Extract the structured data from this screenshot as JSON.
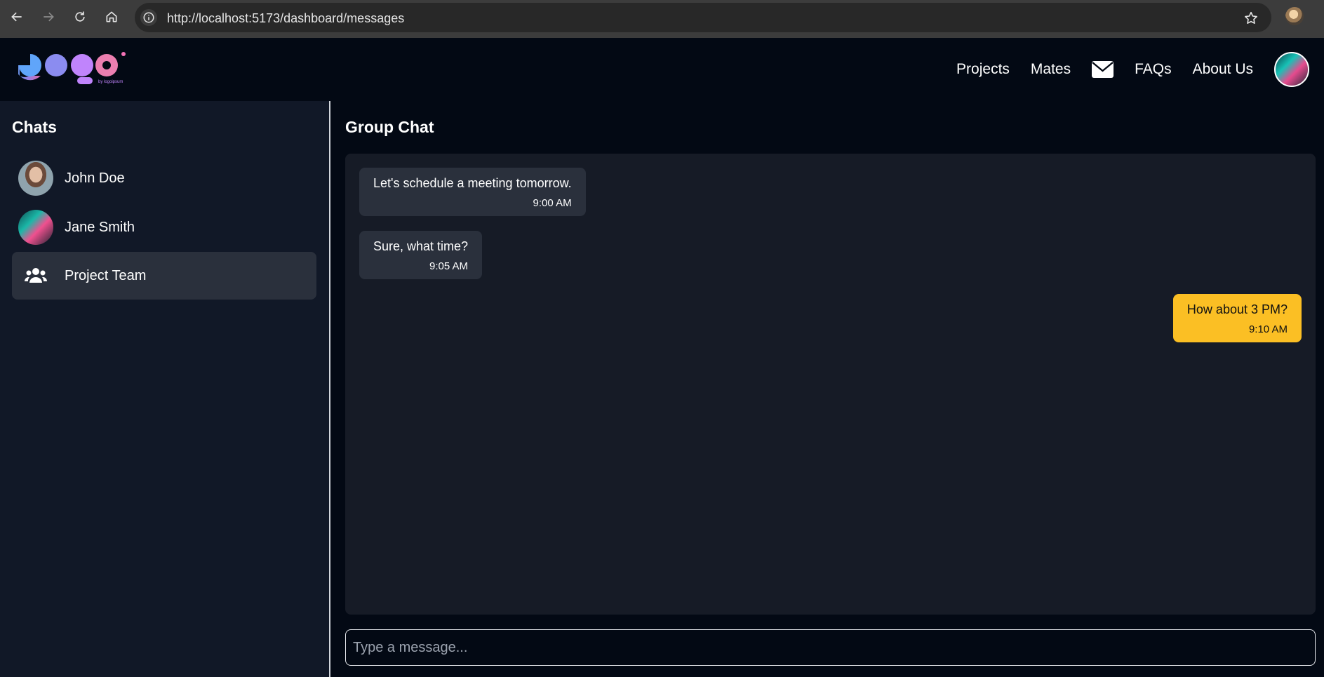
{
  "browser": {
    "url": "http://localhost:5173/dashboard/messages",
    "icons": [
      "back-arrow-icon",
      "forward-arrow-icon",
      "reload-icon",
      "home-icon",
      "info-icon",
      "star-icon"
    ]
  },
  "header": {
    "nav": {
      "projects": "Projects",
      "mates": "Mates",
      "faqs": "FAQs",
      "about": "About Us"
    },
    "icons": [
      "mail-icon"
    ]
  },
  "sidebar": {
    "title": "Chats",
    "items": [
      {
        "name": "John Doe",
        "avatar": "photo"
      },
      {
        "name": "Jane Smith",
        "avatar": "photo"
      },
      {
        "name": "Project Team",
        "avatar": "users-icon",
        "active": true
      }
    ]
  },
  "main": {
    "title": "Group Chat",
    "messages": [
      {
        "text": "Let's schedule a meeting tomorrow.",
        "time": "9:00 AM",
        "direction": "incoming"
      },
      {
        "text": "Sure, what time?",
        "time": "9:05 AM",
        "direction": "incoming"
      },
      {
        "text": "How about 3 PM?",
        "time": "9:10 AM",
        "direction": "outgoing"
      }
    ],
    "composer_placeholder": "Type a message..."
  },
  "colors": {
    "page_bg": "#030914",
    "sidebar_bg": "#111827",
    "messages_bg": "#161b26",
    "incoming_bubble": "#2a303c",
    "outgoing_bubble": "#fbbf24"
  }
}
